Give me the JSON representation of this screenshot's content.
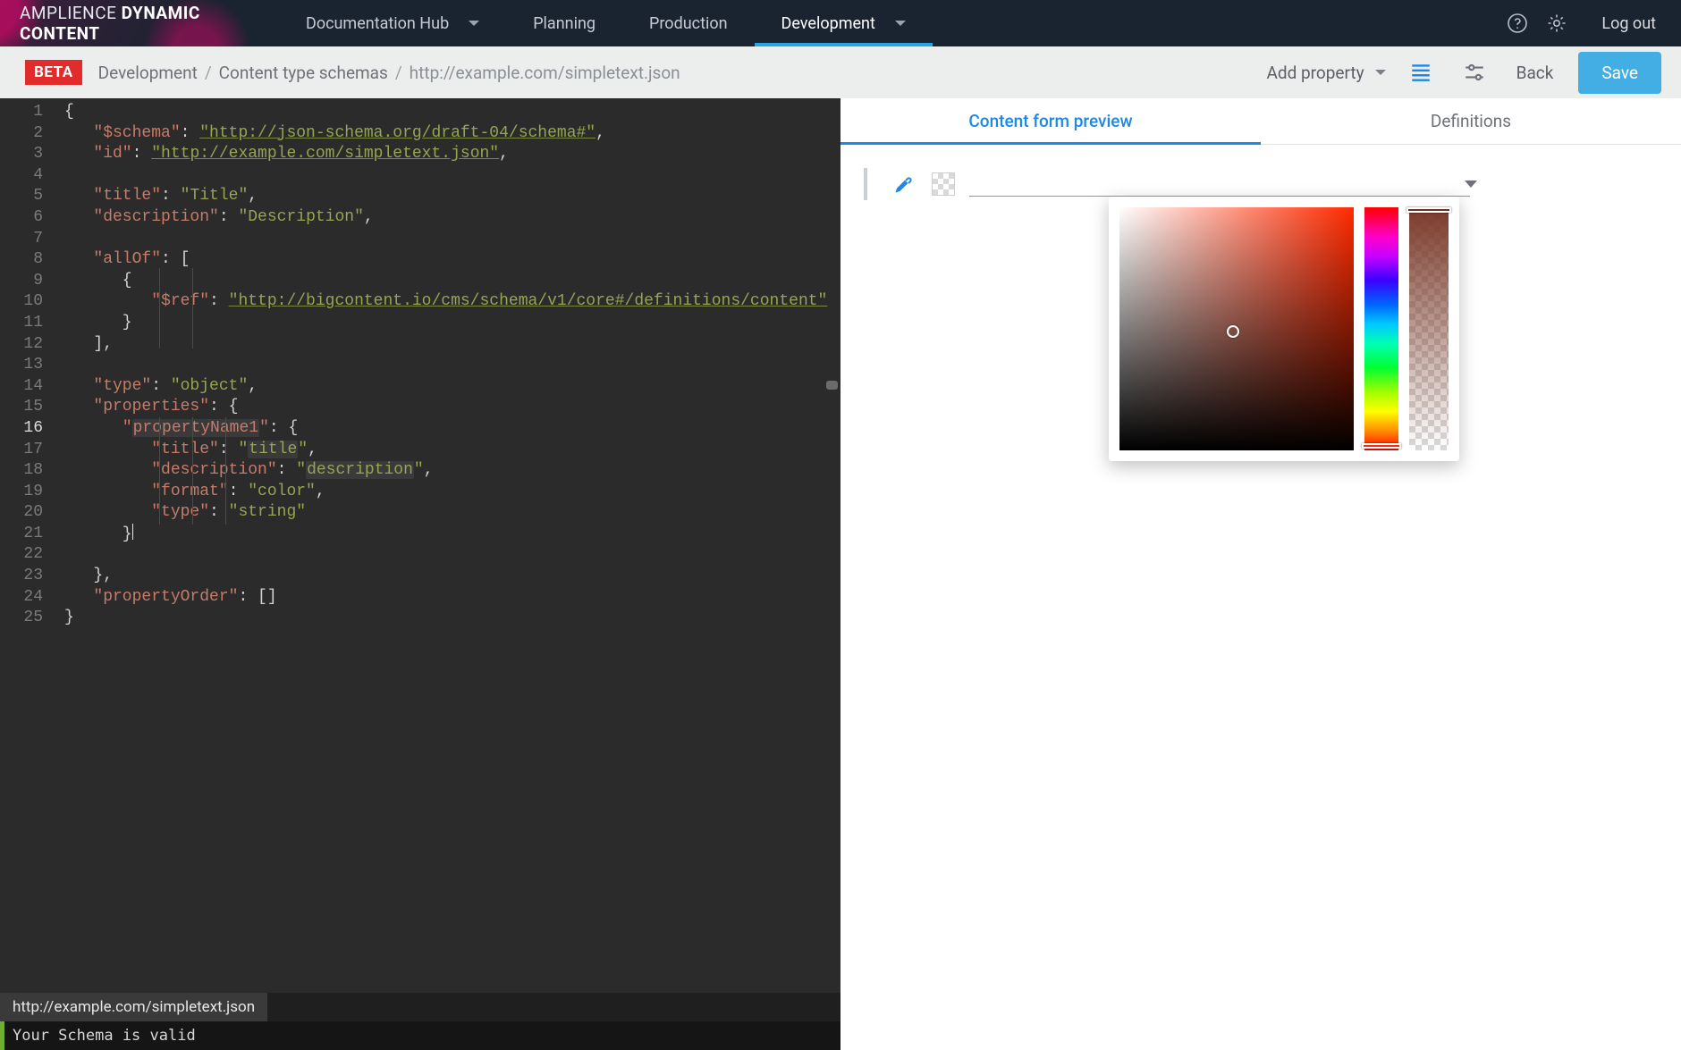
{
  "brand": {
    "light": "AMPLIENCE",
    "bold": "DYNAMIC CONTENT"
  },
  "nav": {
    "items": [
      {
        "label": "Documentation Hub",
        "dropdown": true
      },
      {
        "label": "Planning"
      },
      {
        "label": "Production"
      },
      {
        "label": "Development",
        "active": true,
        "dropdown": true
      }
    ],
    "logout": "Log out"
  },
  "subbar": {
    "badge": "BETA",
    "crumbs": [
      "Development",
      "Content type schemas",
      "http://example.com/simpletext.json"
    ],
    "add_property": "Add property",
    "back": "Back",
    "save": "Save"
  },
  "editor": {
    "lines": 25,
    "current_line": 16,
    "file_tab": "http://example.com/simpletext.json",
    "status": "Your Schema is valid",
    "schema_url": "http://json-schema.org/draft-04/schema#",
    "id_url": "http://example.com/simpletext.json",
    "title_val": "Title",
    "description_val": "Description",
    "ref_url": "http://bigcontent.io/cms/schema/v1/core#/definitions/content",
    "type_object": "object",
    "prop_name": "propertyName1",
    "prop_title": "title",
    "prop_description": "description",
    "prop_format": "color",
    "prop_type": "string",
    "keys": {
      "schema": "$schema",
      "id": "id",
      "title": "title",
      "description": "description",
      "allOf": "allOf",
      "ref": "$ref",
      "type": "type",
      "properties": "properties",
      "format": "format",
      "propertyOrder": "propertyOrder"
    }
  },
  "right": {
    "tabs": [
      "Content form preview",
      "Definitions"
    ],
    "active_tab": 0
  },
  "picker": {
    "hue_deg": 10,
    "sat": 0.46,
    "val": 0.49,
    "alpha": 1.0
  }
}
